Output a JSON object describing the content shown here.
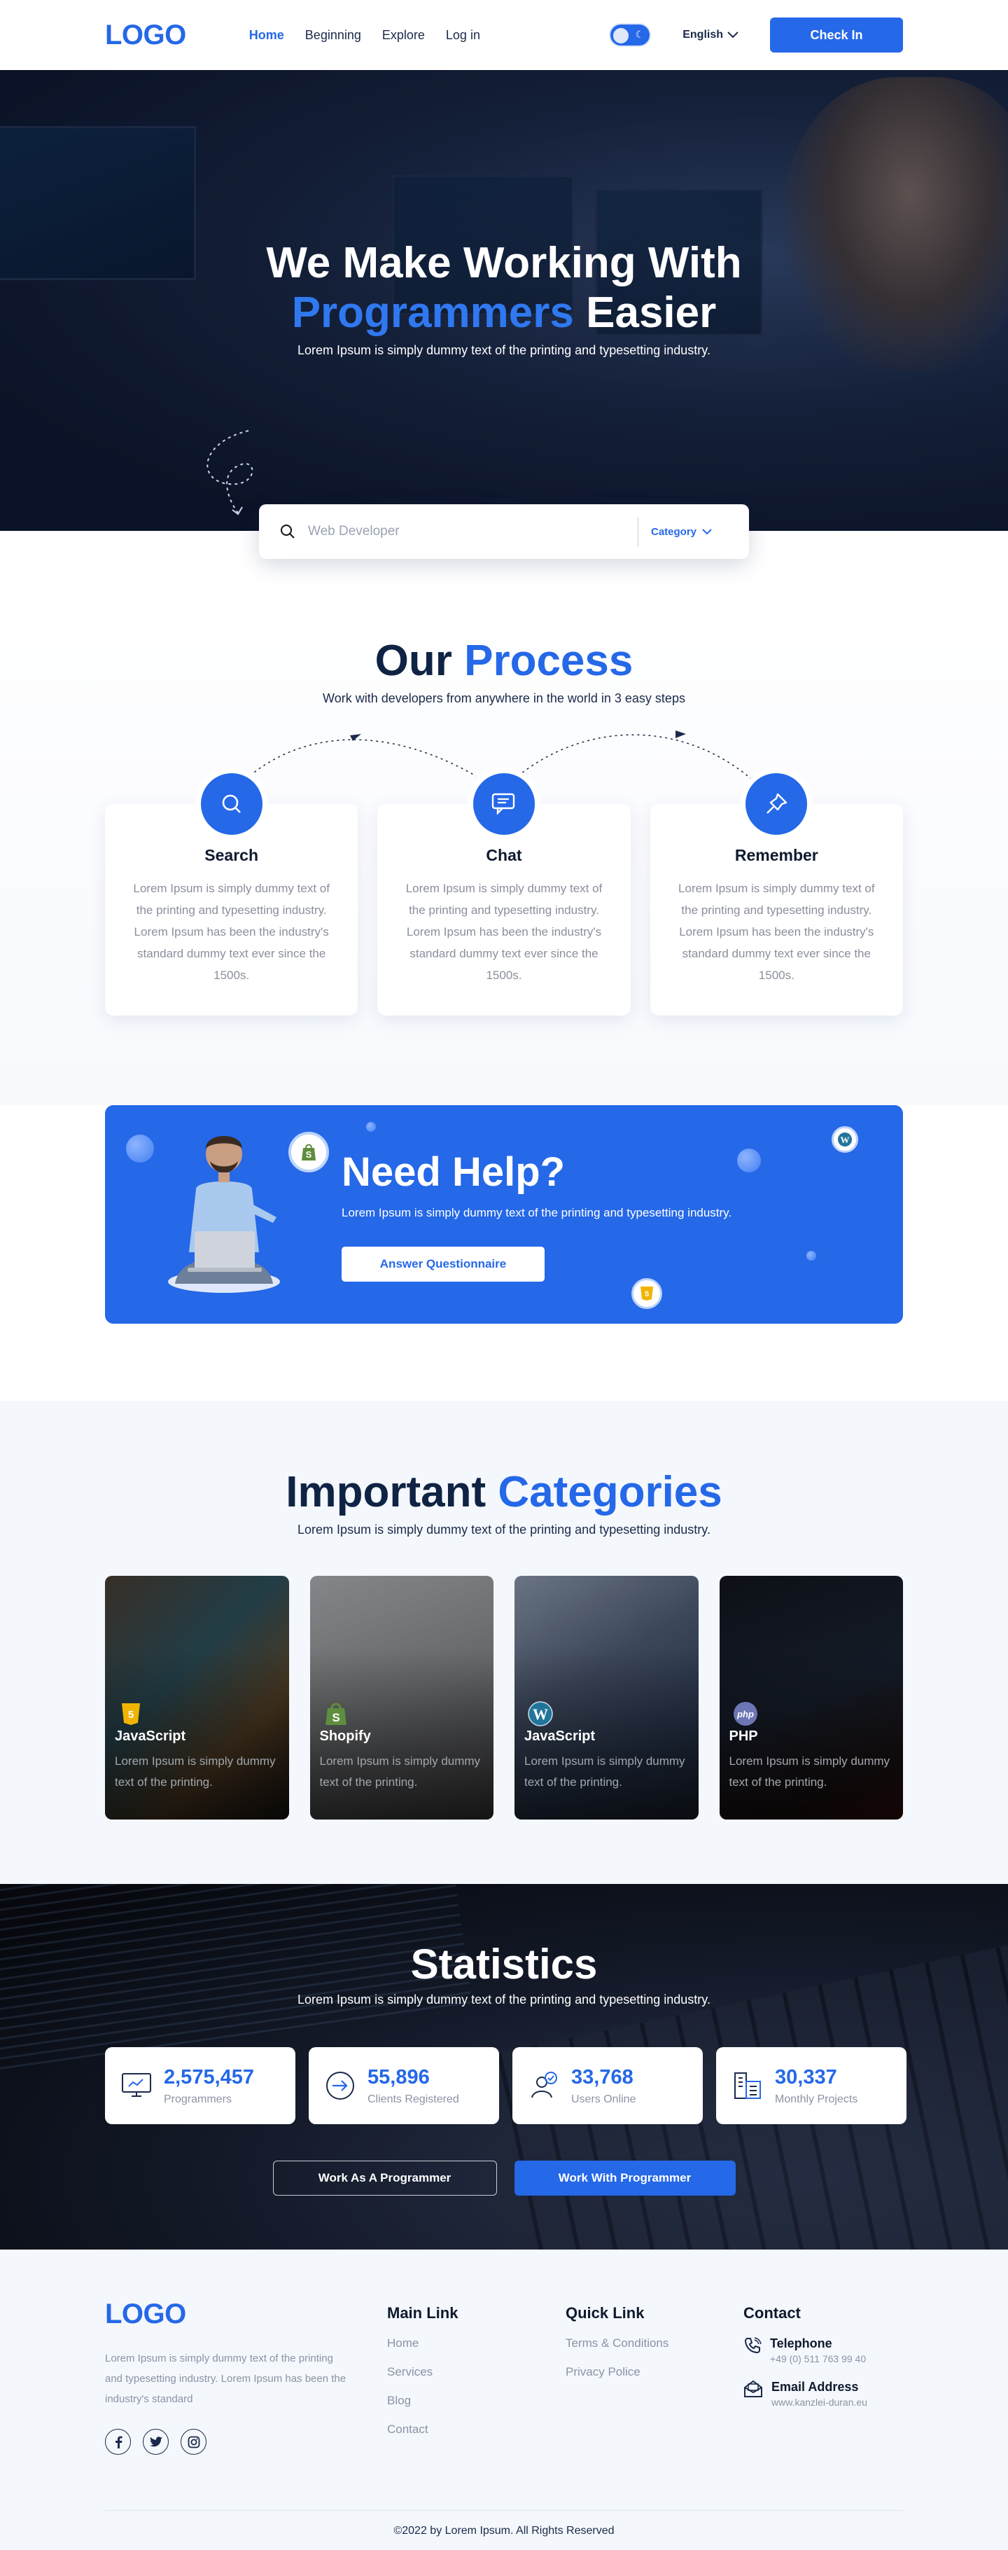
{
  "nav": {
    "logo": "LOGO",
    "links": [
      "Home",
      "Beginning",
      "Explore",
      "Log in"
    ],
    "language": "English",
    "cta": "Check In"
  },
  "hero": {
    "title_line1": "We Make Working With",
    "title_blue": "Programmers",
    "title_end": " Easier",
    "subtitle": "Lorem Ipsum is simply dummy text of the printing and typesetting industry.",
    "search_placeholder": "Web Developer",
    "category_label": "Category"
  },
  "process": {
    "title": "Our",
    "title_blue": " Process",
    "subtitle": "Work with developers from anywhere in the world in 3 easy steps",
    "steps": [
      {
        "icon": "search-icon",
        "title": "Search",
        "text": "Lorem Ipsum is simply dummy text of the printing and typesetting industry. Lorem Ipsum has been the industry's standard dummy text ever since the 1500s."
      },
      {
        "icon": "chat-icon",
        "title": "Chat",
        "text": "Lorem Ipsum is simply dummy text of the printing and typesetting industry. Lorem Ipsum has been the industry's standard dummy text ever since the 1500s."
      },
      {
        "icon": "pin-icon",
        "title": "Remember",
        "text": "Lorem Ipsum is simply dummy text of the printing and typesetting industry. Lorem Ipsum has been the industry's standard dummy text ever since the 1500s."
      }
    ]
  },
  "help": {
    "title": "Need Help?",
    "text": "Lorem Ipsum is simply dummy text of the printing and typesetting industry.",
    "button": "Answer Questionnaire"
  },
  "categories": {
    "title": "Important",
    "title_blue": " Categories",
    "subtitle": "Lorem Ipsum is simply dummy text of the printing and typesetting industry.",
    "items": [
      {
        "icon": "html5-icon",
        "name": "JavaScript",
        "text": "Lorem Ipsum is simply dummy text of the printing."
      },
      {
        "icon": "shopify-icon",
        "name": "Shopify",
        "text": "Lorem Ipsum is simply dummy text of the printing."
      },
      {
        "icon": "wordpress-icon",
        "name": "JavaScript",
        "text": "Lorem Ipsum is simply dummy text of the printing."
      },
      {
        "icon": "php-icon",
        "name": "PHP",
        "text": "Lorem Ipsum is simply dummy text of the printing."
      }
    ]
  },
  "statistics": {
    "title": "Statistics",
    "subtitle": "Lorem Ipsum is simply dummy text of the printing and typesetting industry.",
    "items": [
      {
        "icon": "monitor-icon",
        "value": "2,575,457",
        "label": "Programmers"
      },
      {
        "icon": "login-icon",
        "value": "55,896",
        "label": "Clients Registered"
      },
      {
        "icon": "users-online-icon",
        "value": "33,768",
        "label": "Users Online"
      },
      {
        "icon": "projects-icon",
        "value": "30,337",
        "label": "Monthly Projects"
      }
    ],
    "btn_outline": "Work As A Programmer",
    "btn_primary": "Work With Programmer"
  },
  "footer": {
    "logo": "LOGO",
    "description": "Lorem Ipsum is simply dummy text of the printing and typesetting industry. Lorem Ipsum has been the industry's standard",
    "main_title": "Main Link",
    "main_links": [
      "Home",
      "Services",
      "Blog",
      "Contact"
    ],
    "quick_title": "Quick Link",
    "quick_links": [
      "Terms & Conditions",
      "Privacy Police"
    ],
    "contact_title": "Contact",
    "phone_label": "Telephone",
    "phone": "+49 (0) 511 763 99 40",
    "email_label": "Email Address",
    "email": "www.kanzlei-duran.eu",
    "copyright": "©2022 by Lorem Ipsum. All Rights Reserved"
  },
  "colors": {
    "accent": "#2568e8",
    "dark": "#0f2344"
  }
}
